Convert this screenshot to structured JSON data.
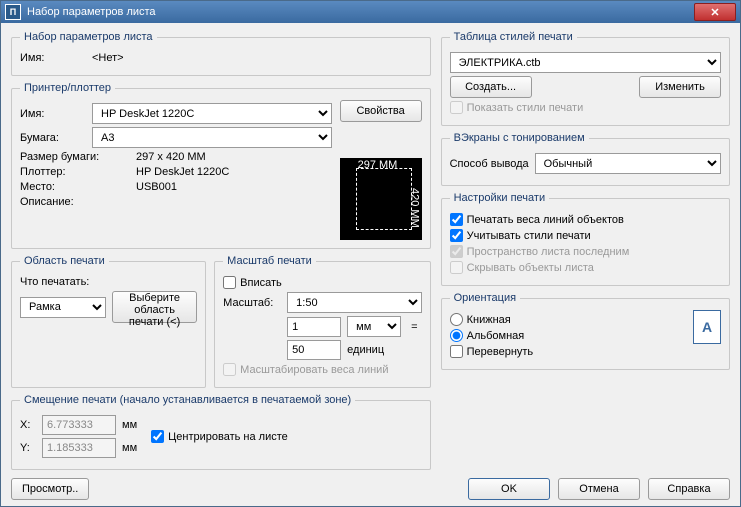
{
  "window": {
    "title": "Набор параметров листа"
  },
  "pageSetup": {
    "legend": "Набор параметров листа",
    "nameLabel": "Имя:",
    "nameValue": "<Нет>"
  },
  "printer": {
    "legend": "Принтер/плоттер",
    "nameLabel": "Имя:",
    "nameValue": "HP DeskJet 1220C",
    "propsBtn": "Свойства",
    "paperLabel": "Бумага:",
    "paperValue": "A3",
    "sizeLabel": "Размер бумаги:",
    "sizeValue": "297 x 420  MM",
    "plotterLabel": "Плоттер:",
    "plotterValue": "HP DeskJet 1220C",
    "whereLabel": "Место:",
    "whereValue": "USB001",
    "descLabel": "Описание:",
    "preview": {
      "w": "297 MM",
      "h": "420 MM"
    }
  },
  "plotArea": {
    "legend": "Область печати",
    "whatLabel": "Что печатать:",
    "whatValue": "Рамка",
    "windowBtn": "Выберите область печати (<)"
  },
  "scale": {
    "legend": "Масштаб печати",
    "fit": "Вписать",
    "scaleLabel": "Масштаб:",
    "scaleValue": "1:50",
    "unitsTop": "1",
    "unitsSel": "мм",
    "unitsBottom": "50",
    "unitsLabel": "единиц",
    "scaleLw": "Масштабировать веса линий"
  },
  "offset": {
    "legend": "Смещение печати (начало устанавливается в печатаемой зоне)",
    "x": "X:",
    "xval": "6.773333",
    "xmm": "мм",
    "y": "Y:",
    "yval": "1.185333",
    "ymm": "мм",
    "center": "Центрировать на листе"
  },
  "styleTable": {
    "legend": "Таблица стилей печати",
    "value": "ЭЛЕКТРИКА.ctb",
    "createBtn": "Создать...",
    "editBtn": "Изменить",
    "show": "Показать стили печати"
  },
  "shaded": {
    "legend": "ВЭкраны с тонированием",
    "methodLabel": "Способ вывода",
    "methodValue": "Обычный"
  },
  "options": {
    "legend": "Настройки печати",
    "lw": "Печатать веса линий объектов",
    "styles": "Учитывать стили печати",
    "paperspace": "Пространство листа последним",
    "hide": "Скрывать объекты листа"
  },
  "orient": {
    "legend": "Ориентация",
    "portrait": "Книжная",
    "landscape": "Альбомная",
    "upside": "Перевернуть"
  },
  "footer": {
    "preview": "Просмотр..",
    "ok": "OK",
    "cancel": "Отмена",
    "help": "Справка"
  }
}
